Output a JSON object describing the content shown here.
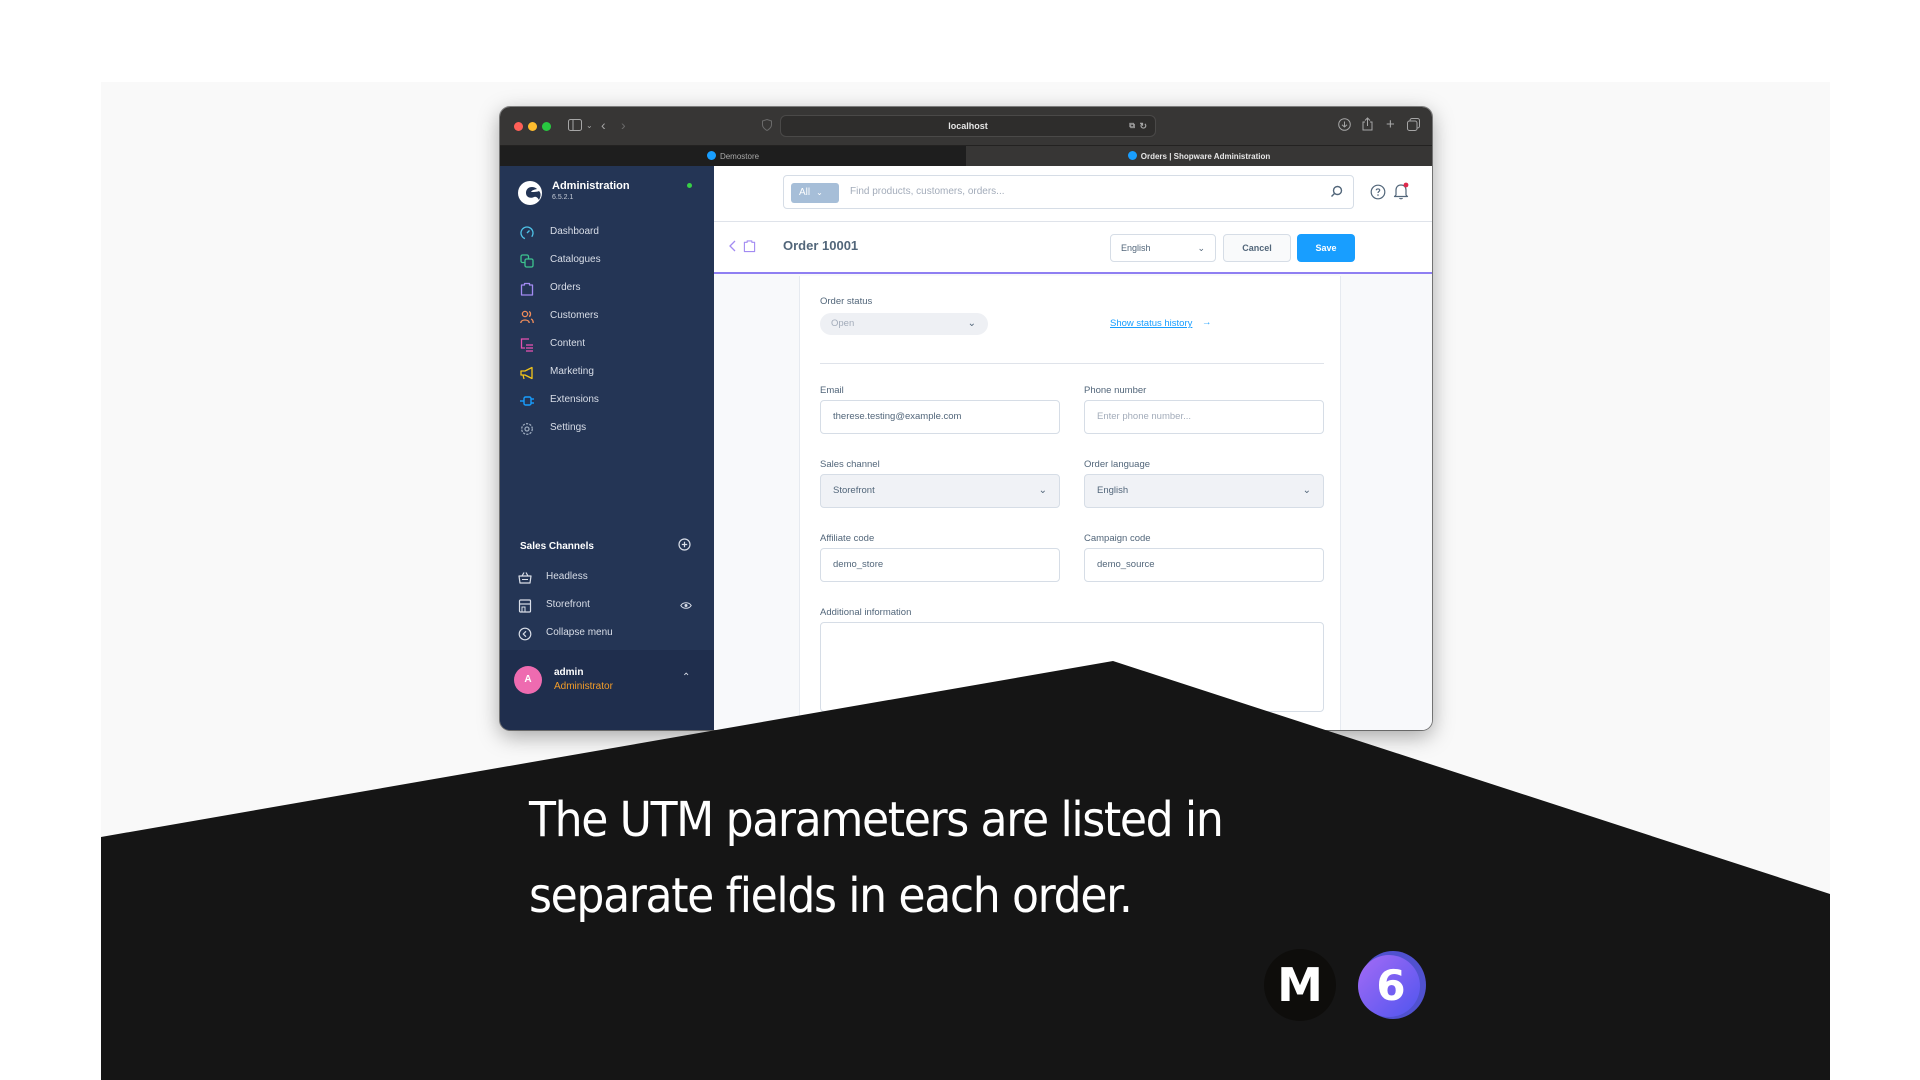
{
  "browser": {
    "url": "localhost",
    "tabs": [
      {
        "label": "Demostore",
        "active": false
      },
      {
        "label": "Orders | Shopware Administration",
        "active": true
      }
    ]
  },
  "sidebar": {
    "brand_title": "Administration",
    "version": "6.5.2.1",
    "items": [
      {
        "label": "Dashboard",
        "icon": "dashboard-icon",
        "color": "#4fc3e8"
      },
      {
        "label": "Catalogues",
        "icon": "catalogues-icon",
        "color": "#3dc48f"
      },
      {
        "label": "Orders",
        "icon": "orders-icon",
        "color": "#a28bf2"
      },
      {
        "label": "Customers",
        "icon": "customers-icon",
        "color": "#f08d5b"
      },
      {
        "label": "Content",
        "icon": "content-icon",
        "color": "#e451b0"
      },
      {
        "label": "Marketing",
        "icon": "marketing-icon",
        "color": "#f2c419"
      },
      {
        "label": "Extensions",
        "icon": "extensions-icon",
        "color": "#189eff"
      },
      {
        "label": "Settings",
        "icon": "settings-icon",
        "color": "#9aa8bc"
      }
    ],
    "sales_channels_title": "Sales Channels",
    "sales_channels": [
      {
        "label": "Headless",
        "icon": "basket-icon"
      },
      {
        "label": "Storefront",
        "icon": "storefront-icon"
      }
    ],
    "collapse_label": "Collapse menu",
    "user": {
      "initial": "A",
      "name": "admin",
      "role": "Administrator"
    }
  },
  "topbar": {
    "search_type": "All",
    "search_placeholder": "Find products, customers, orders..."
  },
  "smartbar": {
    "title": "Order 10001",
    "language": "English",
    "cancel_label": "Cancel",
    "save_label": "Save"
  },
  "form": {
    "order_status_label": "Order status",
    "order_status_value": "Open",
    "status_history_link": "Show status history",
    "status_history_arrow": "→",
    "email_label": "Email",
    "email_value": "therese.testing@example.com",
    "phone_label": "Phone number",
    "phone_placeholder": "Enter phone number...",
    "sales_channel_label": "Sales channel",
    "sales_channel_value": "Storefront",
    "order_language_label": "Order language",
    "order_language_value": "English",
    "affiliate_label": "Affiliate code",
    "affiliate_value": "demo_store",
    "campaign_label": "Campaign code",
    "campaign_value": "demo_source",
    "additional_label": "Additional information",
    "additional_value": ""
  },
  "caption": {
    "line1": "The UTM parameters are listed in",
    "line2": "separate fields in each order."
  },
  "logos": {
    "m_letter": "M",
    "six_digit": "6"
  },
  "colors": {
    "accent": "#189eff",
    "sidebar_bg": "#243555",
    "smartbar_border": "#8f7ff2",
    "role_color": "#f29c29",
    "avatar_color": "#ee6bb0"
  }
}
